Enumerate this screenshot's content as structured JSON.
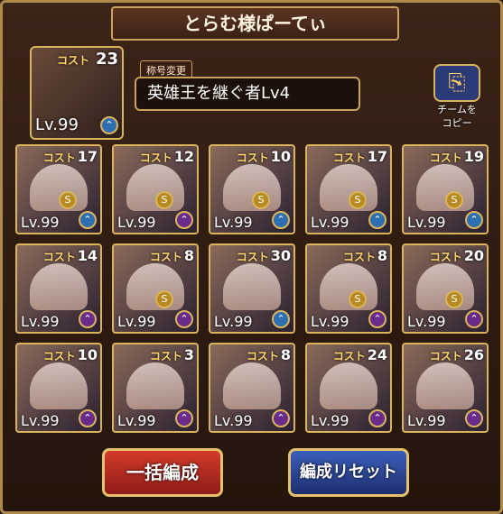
{
  "header": {
    "title": "とらむ様ぱーてぃ"
  },
  "leader": {
    "cost_label": "コスト",
    "cost": "23",
    "level": "Lv.99",
    "badge": "blue"
  },
  "title_area": {
    "tag": "称号変更",
    "value": "英雄王を継ぐ者Lv4"
  },
  "team_copy": {
    "line1": "チームを",
    "line2": "コピー"
  },
  "cost_label": "コスト",
  "s_label": "S",
  "cards": [
    {
      "cost": "17",
      "level": "Lv.99",
      "badge": "blue",
      "s": true
    },
    {
      "cost": "12",
      "level": "Lv.99",
      "badge": "purple",
      "s": true
    },
    {
      "cost": "10",
      "level": "Lv.99",
      "badge": "blue",
      "s": true
    },
    {
      "cost": "17",
      "level": "Lv.99",
      "badge": "blue",
      "s": true
    },
    {
      "cost": "19",
      "level": "Lv.99",
      "badge": "blue",
      "s": true
    },
    {
      "cost": "14",
      "level": "Lv.99",
      "badge": "purple",
      "s": false
    },
    {
      "cost": "8",
      "level": "Lv.99",
      "badge": "purple",
      "s": true
    },
    {
      "cost": "30",
      "level": "Lv.99",
      "badge": "blue",
      "s": false
    },
    {
      "cost": "8",
      "level": "Lv.99",
      "badge": "purple",
      "s": true
    },
    {
      "cost": "20",
      "level": "Lv.99",
      "badge": "purple",
      "s": true
    },
    {
      "cost": "10",
      "level": "Lv.99",
      "badge": "purple",
      "s": false
    },
    {
      "cost": "3",
      "level": "Lv.99",
      "badge": "purple",
      "s": false
    },
    {
      "cost": "8",
      "level": "Lv.99",
      "badge": "purple",
      "s": false
    },
    {
      "cost": "24",
      "level": "Lv.99",
      "badge": "purple",
      "s": false
    },
    {
      "cost": "26",
      "level": "Lv.99",
      "badge": "purple",
      "s": false
    }
  ],
  "buttons": {
    "bulk": "一括編成",
    "reset": "編成リセット"
  }
}
